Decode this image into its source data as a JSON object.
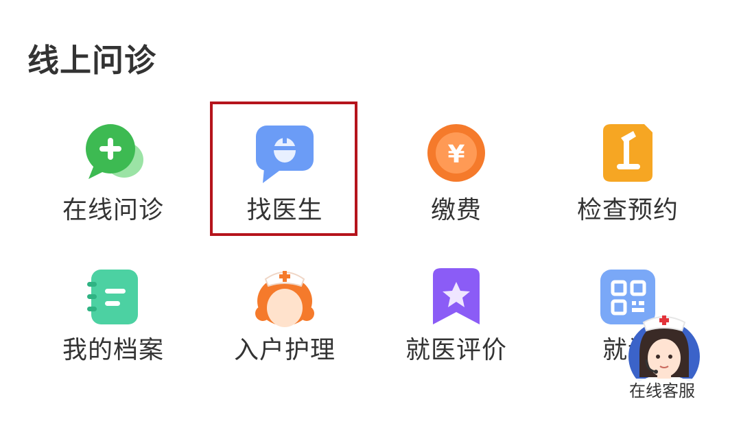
{
  "section": {
    "title": "线上问诊"
  },
  "grid": [
    {
      "label": "在线问诊",
      "icon": "chat-plus-icon"
    },
    {
      "label": "找医生",
      "icon": "doctor-chat-icon"
    },
    {
      "label": "缴费",
      "icon": "yuan-coin-icon"
    },
    {
      "label": "检查预约",
      "icon": "microscope-icon"
    },
    {
      "label": "我的档案",
      "icon": "notebook-icon"
    },
    {
      "label": "入户护理",
      "icon": "nurse-icon"
    },
    {
      "label": "就医评价",
      "icon": "star-bookmark-icon"
    },
    {
      "label": "就诊",
      "icon": "qr-code-icon"
    }
  ],
  "service": {
    "label": "在线客服",
    "icon": "nurse-avatar-icon"
  },
  "colors": {
    "highlight": "#b5141c",
    "green": "#3dba52",
    "blue": "#6b9cf6",
    "orange": "#f57a2b",
    "amber": "#f6a623",
    "mint": "#4cd1a2",
    "purple": "#8b5cf6",
    "sky": "#7aa8f7"
  }
}
